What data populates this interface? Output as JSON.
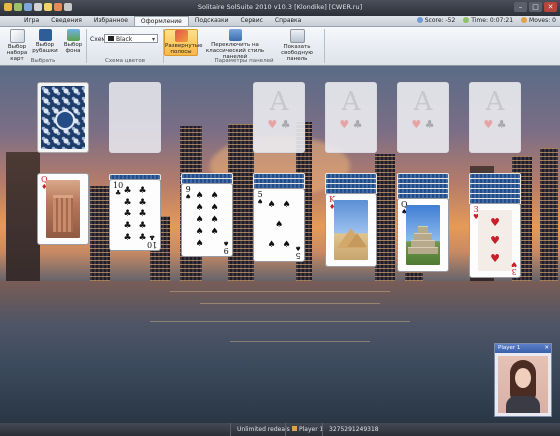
{
  "titlebar": {
    "title": "Solitaire SolSuite 2010 v10.3  [Klondike]  [CWER.ru]"
  },
  "menu": {
    "items": [
      "Игра",
      "Сведения",
      "Избранное",
      "Оформление",
      "Подсказки",
      "Сервис",
      "Справка"
    ],
    "active_index": 3
  },
  "stats": {
    "score_label": "Score: -52",
    "time_label": "Time: 0:07:21",
    "moves_label": "Moves: 0"
  },
  "ribbon": {
    "btn_card_set": "Выбор набора карт",
    "btn_card_back": "Выбор рубашки",
    "btn_background": "Выбор фона",
    "group_choose": "Выбрать",
    "scheme_label": "Схем",
    "scheme_value": "Black",
    "group_scheme": "Схема цветов",
    "btn_expanded_strips": "Развернутые полосы",
    "btn_classic_style": "Переключить на классический стиль панелей",
    "btn_free_panel": "Показать свободную панель",
    "group_panels": "Параметры панелей"
  },
  "tableau": {
    "col1_top": {
      "rank": "Q",
      "suit": "♦",
      "color": "red"
    },
    "col2_top": {
      "rank": "10",
      "suit": "♣",
      "color": "black"
    },
    "col3_top": {
      "rank": "9",
      "suit": "♠",
      "color": "black"
    },
    "col4_top": {
      "rank": "5",
      "suit": "♠",
      "color": "black"
    },
    "col5_top": {
      "rank": "K",
      "suit": "♦",
      "color": "red"
    },
    "col6_top": {
      "rank": "Q",
      "suit": "♠",
      "color": "black"
    },
    "col7_top": {
      "rank": "3",
      "suit": "♥",
      "color": "red"
    }
  },
  "foundation": {
    "label": "A",
    "suits": [
      "♥",
      "♣",
      "♥",
      "♣"
    ]
  },
  "statusbar": {
    "redeals": "Unlimited redeals",
    "player": "Player 1",
    "game_number": "3275291249318"
  },
  "player_panel": {
    "title": "Player 1",
    "close": "✕"
  },
  "colors": {
    "accent": "#f7b84a",
    "card_red": "#c8202a",
    "card_back": "#244c86"
  }
}
